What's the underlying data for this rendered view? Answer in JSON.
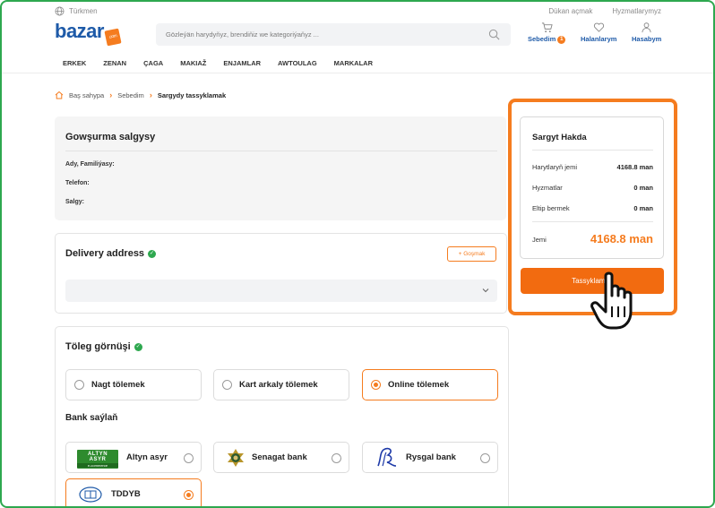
{
  "topbar": {
    "language": "Türkmen",
    "links": [
      "Dükan açmak",
      "Hyzmatlarymyz"
    ]
  },
  "header": {
    "logo": "bazar",
    "logo_tag": ".com",
    "search_placeholder": "Gözleýän harydyňyz, brendiňiz we kategoriýaňyz ...",
    "cart_label": "Sebedim",
    "cart_count": "1",
    "favorites_label": "Halanlarym",
    "account_label": "Hasabym"
  },
  "nav": [
    "ERKEK",
    "ZENAN",
    "ÇAGA",
    "MAKIAŽ",
    "ENJAMLAR",
    "AWTOULAG",
    "MARKALAR"
  ],
  "breadcrumb": {
    "home": "Baş sahypa",
    "cart": "Sebedim",
    "current": "Sargydy tassyklamak"
  },
  "delivery_info": {
    "title": "Gowşurma salgysy",
    "name_label": "Ady, Familiýasy:",
    "phone_label": "Telefon:",
    "address_label": "Salgy:"
  },
  "delivery_address": {
    "title": "Delivery address",
    "add_button": "Goşmak",
    "select_value": ""
  },
  "payment": {
    "title": "Töleg görnüşi",
    "options": [
      {
        "label": "Nagt tölemek",
        "selected": false
      },
      {
        "label": "Kart arkaly tölemek",
        "selected": false
      },
      {
        "label": "Online tölemek",
        "selected": true
      }
    ],
    "bank_title": "Bank saýlaň",
    "banks": [
      {
        "label": "Altyn asyr",
        "logo_text": "ALTYN ASYR",
        "logo_sub": "e-commerce",
        "selected": false
      },
      {
        "label": "Senagat bank",
        "selected": false
      },
      {
        "label": "Rysgal bank",
        "selected": false
      },
      {
        "label": "TDDYB",
        "selected": true
      }
    ]
  },
  "summary": {
    "title": "Sargyt Hakda",
    "rows": [
      {
        "label": "Harytlaryň jemi",
        "value": "4168.8 man"
      },
      {
        "label": "Hyzmatlar",
        "value": "0 man"
      },
      {
        "label": "Eltip bermek",
        "value": "0 man"
      }
    ],
    "total_label": "Jemi",
    "total_value": "4168.8 man",
    "confirm_button": "Tassyklamak"
  },
  "colors": {
    "accent": "#f57c1f",
    "brand": "#1e5aa8",
    "success": "#2ea84f"
  }
}
